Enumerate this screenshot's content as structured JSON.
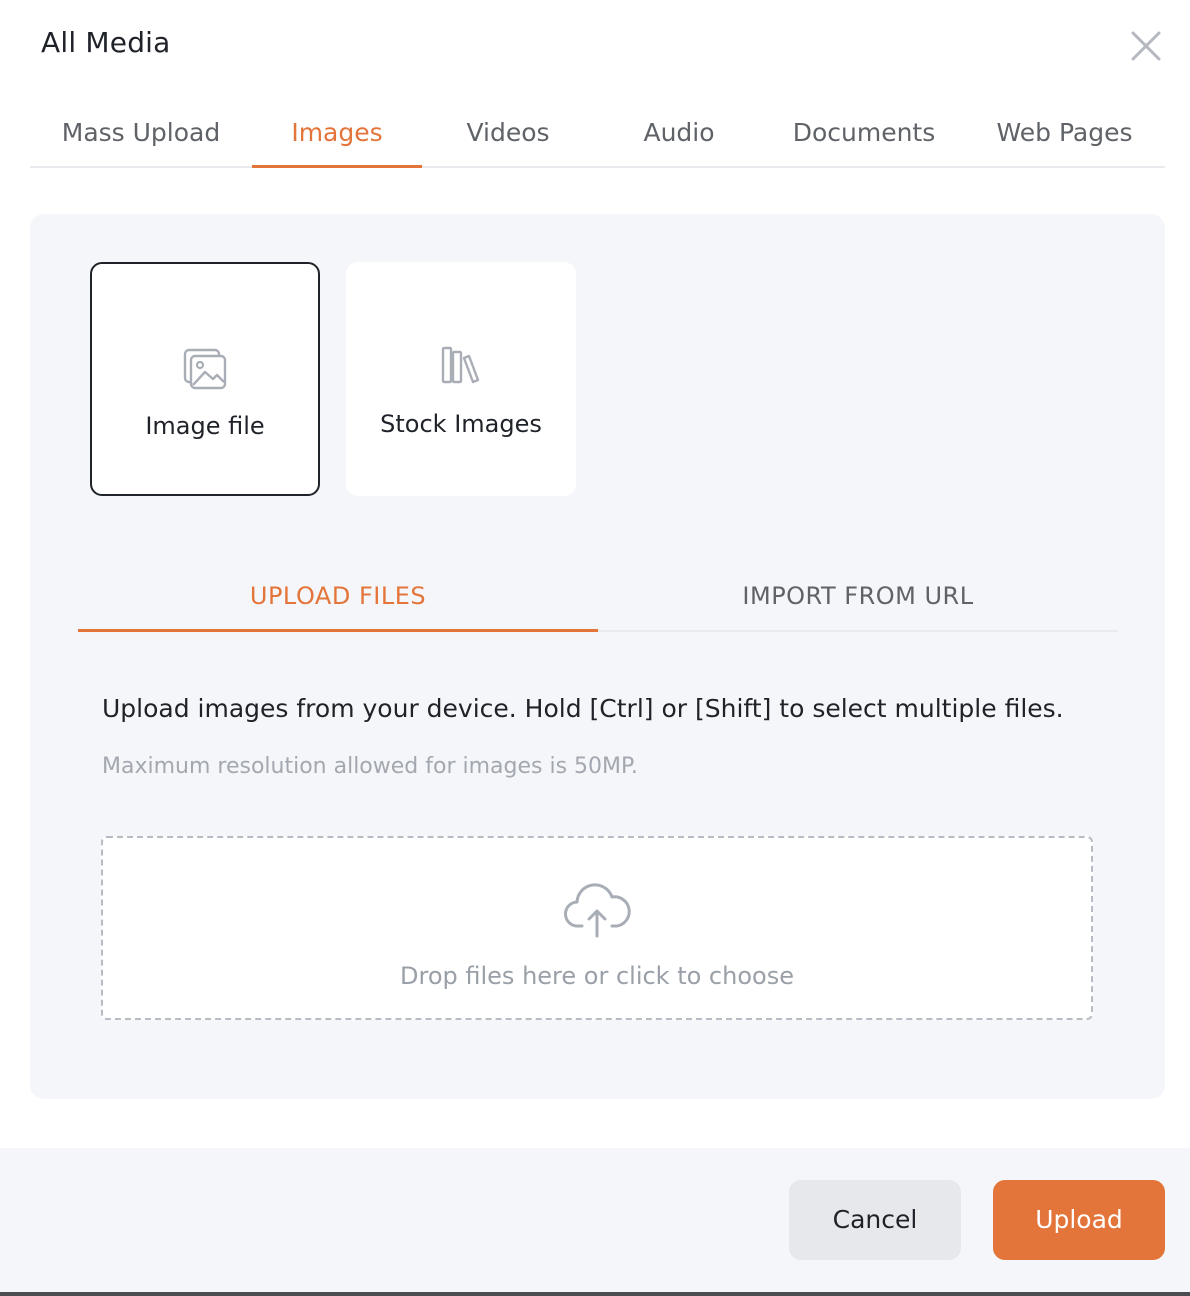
{
  "modal": {
    "title": "All Media",
    "close_icon": "close-icon"
  },
  "tabs": [
    {
      "label": "Mass Upload",
      "active": false
    },
    {
      "label": "Images",
      "active": true
    },
    {
      "label": "Videos",
      "active": false
    },
    {
      "label": "Audio",
      "active": false
    },
    {
      "label": "Documents",
      "active": false
    },
    {
      "label": "Web Pages",
      "active": false
    }
  ],
  "sources": [
    {
      "label": "Image file",
      "icon": "image-file-icon",
      "selected": true
    },
    {
      "label": "Stock Images",
      "icon": "library-icon",
      "selected": false
    }
  ],
  "subtabs": [
    {
      "label": "UPLOAD FILES",
      "active": true
    },
    {
      "label": "IMPORT FROM URL",
      "active": false
    }
  ],
  "upload": {
    "description": "Upload images from your device. Hold [Ctrl] or [Shift] to select multiple files.",
    "note": "Maximum resolution allowed for images is 50MP.",
    "drop_label": "Drop files here or click to choose",
    "drop_icon": "cloud-upload-icon"
  },
  "footer": {
    "cancel_label": "Cancel",
    "upload_label": "Upload"
  },
  "colors": {
    "accent": "#e4753a",
    "panel_bg": "#f5f6f9",
    "text": "#1f2329",
    "muted": "#5f6368"
  }
}
